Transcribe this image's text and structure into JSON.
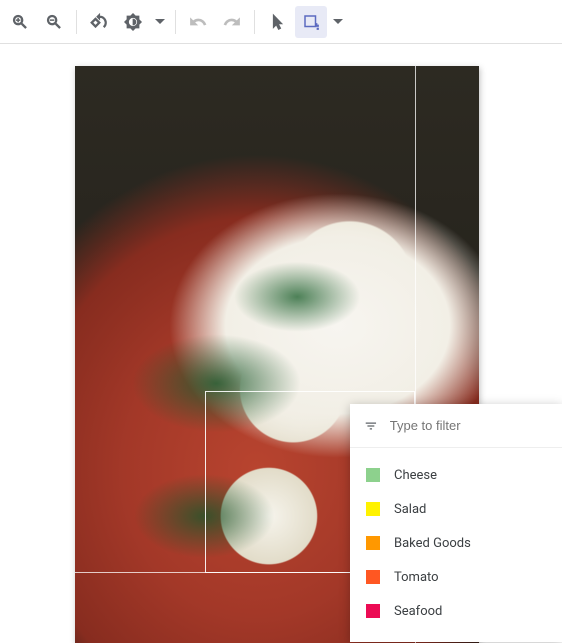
{
  "filter": {
    "placeholder": "Type to filter"
  },
  "labels": [
    {
      "name": "Cheese",
      "color": "#8dd18d"
    },
    {
      "name": "Salad",
      "color": "#fff200"
    },
    {
      "name": "Baked Goods",
      "color": "#ff9800"
    },
    {
      "name": "Tomato",
      "color": "#ff5722"
    },
    {
      "name": "Seafood",
      "color": "#ec0b54"
    }
  ]
}
